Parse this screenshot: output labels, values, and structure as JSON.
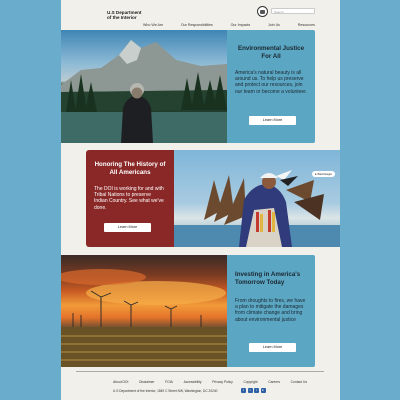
{
  "header": {
    "brand_line1": "U.S Department",
    "brand_line2": "of the Interior",
    "search_placeholder": "Search",
    "nav": [
      "Who We Are",
      "Our Responsibilities",
      "Our Impacts",
      "Join Us",
      "Resources"
    ]
  },
  "sections": [
    {
      "title": "Environmental Justice For All",
      "body": "America's natural beauty is all around us. To help us preserve and protect our resources, join our team or become a volunteer.",
      "button": "Learn More"
    },
    {
      "title": "Honoring The History of All Americans",
      "body": "The DOI is working for and with Tribal Nations to preserve Indian Country. See what we've done.",
      "button": "Learn More",
      "photo_tag": "● Bald Eagle"
    },
    {
      "title": "Investing in America's Tomorrow Today",
      "body": "From droughts to fires, we have a plan to mitigate the damages from climate change and bring about environmental justice",
      "button": "Learn More"
    }
  ],
  "footer": {
    "links": [
      "About DOI",
      "Disclaimer",
      "FOIA",
      "Accessibility",
      "Privacy Policy",
      "Copyright",
      "Careers",
      "Contact Us"
    ],
    "copyright": "U.S Department of the Interior, 1849 C Street NW, Washington, DC 20240",
    "social_icons": [
      "facebook-icon",
      "twitter-icon",
      "instagram-icon",
      "linkedin-icon"
    ]
  },
  "colors": {
    "background": "#6aaccb",
    "panel_blue": "#5ba7c3",
    "panel_red": "#8a2828",
    "page": "#f2f0ea"
  }
}
